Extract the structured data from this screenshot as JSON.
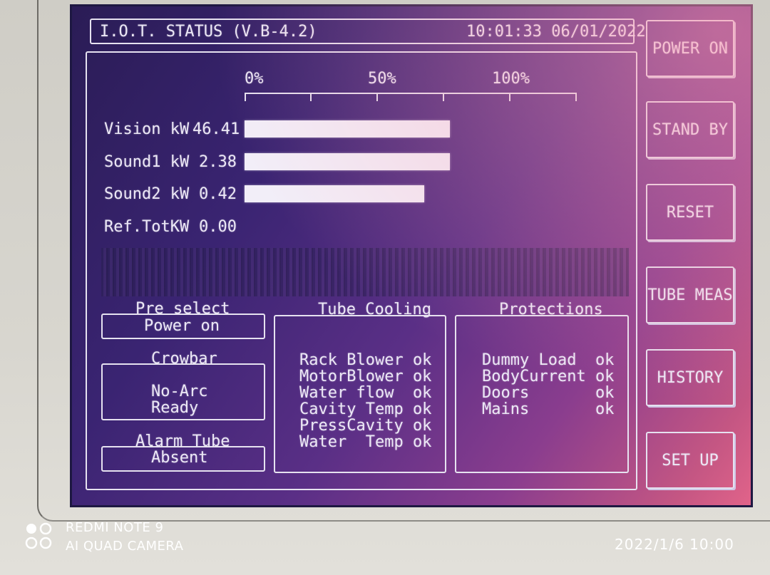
{
  "header": {
    "title": "I.O.T. STATUS (V.B-4.2)",
    "datetime": "10:01:33 06/01/2022"
  },
  "side_buttons": [
    {
      "label": "POWER ON"
    },
    {
      "label": "STAND BY"
    },
    {
      "label": "RESET"
    },
    {
      "label": "TUBE MEAS"
    },
    {
      "label": "HISTORY"
    },
    {
      "label": "SET UP"
    }
  ],
  "scale": {
    "labels": [
      "0%",
      "50%",
      "100%"
    ]
  },
  "meters": [
    {
      "label": "Vision kW",
      "value": "46.41",
      "percent": 80
    },
    {
      "label": "Sound1 kW",
      "value": "2.38",
      "percent": 80
    },
    {
      "label": "Sound2 kW",
      "value": "0.42",
      "percent": 70
    },
    {
      "label": "Ref.TotKW",
      "value": "0.00",
      "percent": 0
    }
  ],
  "preselect": {
    "title": "Pre select",
    "value": "Power on"
  },
  "crowbar": {
    "title": "Crowbar",
    "line1": "No-Arc",
    "line2": "Ready"
  },
  "alarm_tube": {
    "title": "Alarm Tube",
    "value": "Absent"
  },
  "tube_cooling": {
    "title": "Tube Cooling",
    "lines": [
      "Rack Blower ok",
      "MotorBlower ok",
      "Water flow  ok",
      "Cavity Temp ok",
      "PressCavity ok",
      "Water  Temp ok"
    ]
  },
  "protections": {
    "title": "Protections",
    "lines": [
      "Dummy Load  ok",
      "BodyCurrent ok",
      "Doors       ok",
      "Mains       ok"
    ]
  },
  "watermark": {
    "line1": "REDMI NOTE 9",
    "line2": "AI QUAD CAMERA",
    "date": "2022/1/6 10:00"
  }
}
